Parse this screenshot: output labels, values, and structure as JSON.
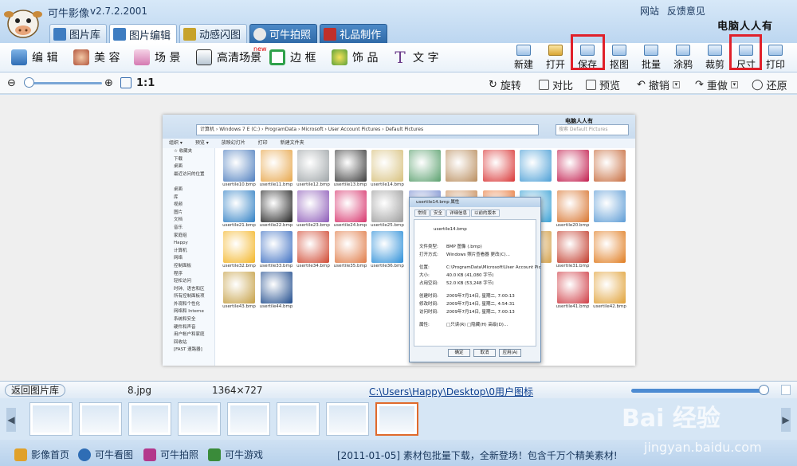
{
  "app": {
    "title": "可牛影像",
    "version": "v2.7.2.2001",
    "links": [
      "网站",
      "反馈意见"
    ],
    "brand_overlay": "电脑人人有"
  },
  "tabs": [
    {
      "label": "图片库",
      "color": "#3f7dc1"
    },
    {
      "label": "图片编辑",
      "color": "#3f7dc1",
      "active": true
    },
    {
      "label": "动感闪图",
      "color": "#c7a22a"
    },
    {
      "label": "可牛拍照",
      "color": "#555555"
    },
    {
      "label": "礼品制作",
      "color": "#c0302a"
    }
  ],
  "tools": [
    {
      "label": "编 辑",
      "icon": "edit-icon"
    },
    {
      "label": "美 容",
      "icon": "face-icon"
    },
    {
      "label": "场 景",
      "icon": "scene-icon"
    },
    {
      "label": "高清场景",
      "icon": "hd-scene-icon",
      "badge": "new"
    },
    {
      "label": "边 框",
      "icon": "frame-icon"
    },
    {
      "label": "饰 品",
      "icon": "decoration-icon"
    },
    {
      "label": "文 字",
      "icon": "text-icon"
    }
  ],
  "right_tools": [
    {
      "label": "新建",
      "icon": "new-file-icon"
    },
    {
      "label": "打开",
      "icon": "open-folder-icon"
    },
    {
      "label": "保存",
      "icon": "save-icon",
      "highlighted": true
    },
    {
      "label": "抠图",
      "icon": "cutout-icon"
    },
    {
      "label": "批量",
      "icon": "batch-icon"
    },
    {
      "label": "涂鸦",
      "icon": "doodle-icon"
    },
    {
      "label": "裁剪",
      "icon": "crop-icon"
    },
    {
      "label": "尺寸",
      "icon": "resize-icon",
      "highlighted": true
    },
    {
      "label": "打印",
      "icon": "print-icon"
    }
  ],
  "zoombar": {
    "ratio_label": "1:1",
    "rotate": "旋转",
    "compare": "对比",
    "preview": "预览",
    "undo": "撤销",
    "redo": "重做",
    "restore": "还原"
  },
  "screenshot": {
    "address": "计算机 › Windows 7 E (C:) › ProgramData › Microsoft › User Account Pictures › Default Pictures",
    "search_placeholder": "搜索 Default Pictures",
    "brand": "电脑人人有",
    "menu": [
      "组织 ▾",
      "预览 ▾",
      "放映幻灯片",
      "打印",
      "新建文件夹"
    ],
    "nav": [
      "☆ 收藏夹",
      "下载",
      "桌面",
      "最近访问的位置",
      "",
      "桌面",
      "库",
      "视频",
      "图片",
      "文档",
      "音乐",
      "家庭组",
      "Happy",
      "计算机",
      "网络",
      "控制面板",
      "程序",
      "轻松访问",
      "时钟、语言和区",
      "所有控制面板项",
      "外观和个性化",
      "网络和 Interne",
      "系统和安全",
      "硬件和声音",
      "用户帐户和家庭",
      "回收站",
      "[FAST 速路器]"
    ],
    "thumbs": [
      "usertile10.bmp",
      "usertile11.bmp",
      "usertile12.bmp",
      "usertile13.bmp",
      "usertile14.bmp",
      "",
      "",
      "",
      "",
      "",
      "",
      "usertile21.bmp",
      "usertile22.bmp",
      "usertile23.bmp",
      "usertile24.bmp",
      "usertile25.bmp",
      "",
      "",
      "",
      "",
      "usertile20.bmp",
      "",
      "usertile32.bmp",
      "usertile33.bmp",
      "usertile34.bmp",
      "usertile35.bmp",
      "usertile36.bmp",
      "",
      "",
      "",
      "",
      "usertile31.bmp",
      "",
      "usertile43.bmp",
      "usertile44.bmp",
      "",
      "",
      "",
      "",
      "",
      "",
      "",
      "usertile41.bmp",
      "usertile42.bmp"
    ],
    "thumb_colors": [
      "#4f7fbf",
      "#e7a64a",
      "#9fa5a8",
      "#3b3b3b",
      "#d7c07c",
      "#5aa06e",
      "#b98d5d",
      "#d93535",
      "#4b9fd6",
      "#c21c4d",
      "#c76b3c",
      "#2e7fc4",
      "#222222",
      "#8c5ab8",
      "#d7326b",
      "#9c9c9c",
      "#7a8fd0",
      "#c98e5b",
      "#e8793a",
      "#3aa1d5",
      "#d8742e",
      "#5b9bd5",
      "#f3b526",
      "#3d6fc2",
      "#d04730",
      "#e07a45",
      "#2a8ed8",
      "#6aa86a",
      "#c64b6a",
      "#5a78c8",
      "#d5a24c",
      "#c23a2a",
      "#e07b1e",
      "#c59f43",
      "#1d4a8c",
      "#ffffff",
      "#ffffff",
      "#ffffff",
      "#ffffff",
      "#ffffff",
      "#ffffff",
      "#ffffff",
      "#cf3c44",
      "#e0a035"
    ],
    "dialog": {
      "title": "usertile14.bmp 属性",
      "tabs": [
        "常规",
        "安全",
        "详细信息",
        "以前的版本"
      ],
      "file_name": "usertile14.bmp",
      "rows": [
        [
          "文件类型:",
          "BMP 图像 (.bmp)"
        ],
        [
          "打开方式:",
          "Windows 照片查看器      更改(C)..."
        ],
        [
          "位置:",
          "C:\\ProgramData\\Microsoft\\User Account Pic"
        ],
        [
          "大小:",
          "40.0 KB (41,080 字节)"
        ],
        [
          "占用空间:",
          "52.0 KB (53,248 字节)"
        ],
        [
          "创建时间:",
          "2009年7月14日, 星期二, 7:00:13"
        ],
        [
          "修改时间:",
          "2009年7月14日, 星期二, 4:54:31"
        ],
        [
          "访问时间:",
          "2009年7月14日, 星期二, 7:00:13"
        ],
        [
          "属性:",
          "□只读(R)   □隐藏(H)   高级(D)..."
        ]
      ],
      "buttons": [
        "确定",
        "取消",
        "应用(A)"
      ]
    }
  },
  "status": {
    "back_label": "返回图片库",
    "file_name": "8.jpg",
    "dimensions": "1364×727",
    "path": "C:\\Users\\Happy\\Desktop\\0用户图标"
  },
  "filmstrip": {
    "count": 8,
    "selected_index": 7
  },
  "bottom": {
    "links": [
      {
        "label": "影像首页",
        "icon": "home-cow-icon",
        "color": "#e0a12b"
      },
      {
        "label": "可牛看图",
        "icon": "eye-icon",
        "color": "#2f6db5"
      },
      {
        "label": "可牛拍照",
        "icon": "camera-icon",
        "color": "#b3388c"
      },
      {
        "label": "可牛游戏",
        "icon": "game-icon",
        "color": "#3a8b3a"
      }
    ],
    "news": "[2011-01-05] 素材包批量下载，全新登场！包含千万个精美素材!"
  },
  "watermark": {
    "text": "Bai  经验",
    "url": "jingyan.baidu.com"
  },
  "colors": {
    "accent": "#3f7dc1",
    "highlight_box": "#e0202a",
    "selected_film": "#e06a2b"
  }
}
